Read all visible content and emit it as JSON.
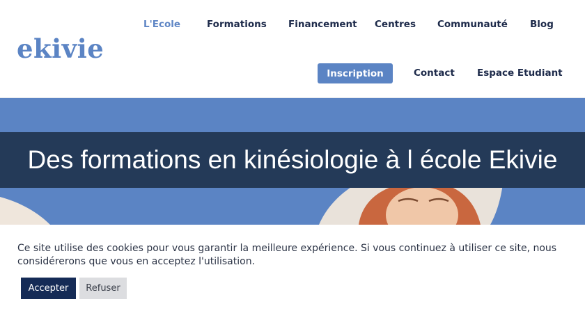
{
  "brand": {
    "logo_text": "ekivie",
    "accent": "#5b84c4",
    "dark": "#243a58"
  },
  "nav": {
    "top": [
      {
        "label": "L'Ecole",
        "active": true
      },
      {
        "label": "Formations"
      },
      {
        "label": "Financement"
      },
      {
        "label": "Centres"
      },
      {
        "label": "Communauté"
      },
      {
        "label": "Blog"
      }
    ],
    "bottom": [
      {
        "label": "Inscription",
        "style": "button"
      },
      {
        "label": "Contact"
      },
      {
        "label": "Espace Etudiant"
      }
    ]
  },
  "hero": {
    "title": "Des formations en kinésiologie à l école Ekivie"
  },
  "cookie_banner": {
    "text": "Ce site utilise des cookies pour vous garantir la meilleure expérience. Si vous continuez à utiliser ce site, nous considérerons que vous en acceptez l'utilisation.",
    "accept_label": "Accepter",
    "refuse_label": "Refuser"
  }
}
